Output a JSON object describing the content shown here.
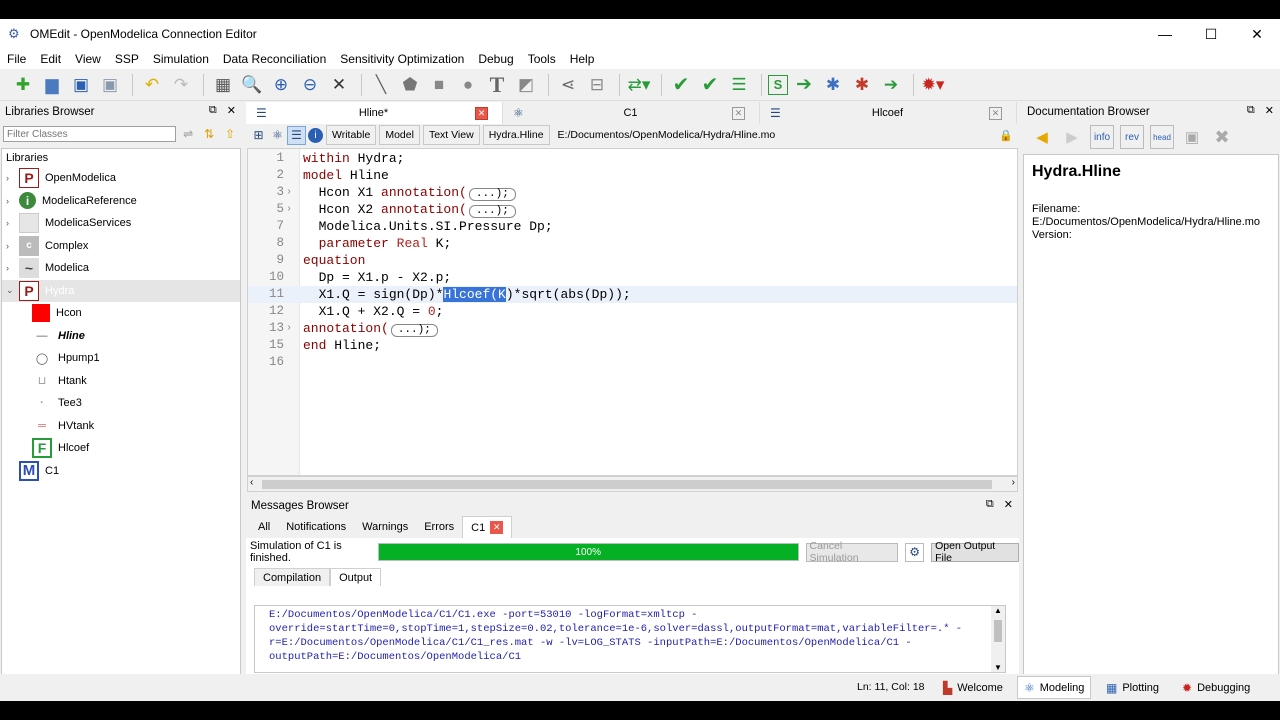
{
  "window": {
    "title": "OMEdit - OpenModelica Connection Editor",
    "minimize": "—",
    "maximize": "☐",
    "close": "✕"
  },
  "menu": [
    "File",
    "Edit",
    "View",
    "SSP",
    "Simulation",
    "Data Reconciliation",
    "Sensitivity Optimization",
    "Debug",
    "Tools",
    "Help"
  ],
  "toolbar_icons": [
    "new-icon",
    "open-icon",
    "save-icon",
    "save-all-icon",
    "undo-icon",
    "redo-icon",
    "grid-icon",
    "zoom-reset-icon",
    "zoom-in-icon",
    "zoom-out-icon",
    "fit-icon",
    "line-icon",
    "polygon-icon",
    "rectangle-icon",
    "ellipse-icon",
    "text-icon",
    "bitmap-icon",
    "connect-icon",
    "transition-icon",
    "check-model-icon",
    "check-all-icon",
    "instantiate-icon",
    "ssp-icon",
    "simulate-icon",
    "simulate-debug-icon",
    "simulate-animation-icon",
    "simulate-alg-icon",
    "debugger-icon"
  ],
  "libraries": {
    "title": "Libraries Browser",
    "filter_placeholder": "Filter Classes",
    "header": "Libraries",
    "items": [
      {
        "label": "OpenModelica",
        "icon": "P",
        "level": 0,
        "arrow": "›"
      },
      {
        "label": "ModelicaReference",
        "icon": "i",
        "level": 0,
        "arrow": "›"
      },
      {
        "label": "ModelicaServices",
        "icon": "",
        "level": 0,
        "arrow": "›"
      },
      {
        "label": "Complex",
        "icon": "c",
        "level": 0,
        "arrow": "›"
      },
      {
        "label": "Modelica",
        "icon": "~",
        "level": 0,
        "arrow": "›"
      },
      {
        "label": "Hydra",
        "icon": "P",
        "level": 0,
        "arrow": "⌄"
      },
      {
        "label": "Hcon",
        "icon": "",
        "level": 1,
        "arrow": ""
      },
      {
        "label": "Hline",
        "icon": "—",
        "level": 1,
        "arrow": ""
      },
      {
        "label": "Hpump1",
        "icon": "◯",
        "level": 1,
        "arrow": ""
      },
      {
        "label": "Htank",
        "icon": "⊔",
        "level": 1,
        "arrow": ""
      },
      {
        "label": "Tee3",
        "icon": "·",
        "level": 1,
        "arrow": ""
      },
      {
        "label": "HVtank",
        "icon": "═",
        "level": 1,
        "arrow": ""
      },
      {
        "label": "Hlcoef",
        "icon": "F",
        "level": 1,
        "arrow": ""
      },
      {
        "label": "C1",
        "icon": "M",
        "level": 0,
        "arrow": ""
      }
    ]
  },
  "editor": {
    "tabs": [
      {
        "label": "Hline*",
        "icon": "☰"
      },
      {
        "label": "C1",
        "icon": "⚛"
      },
      {
        "label": "Hlcoef",
        "icon": "☰"
      }
    ],
    "buttons": [
      "Writable",
      "Model",
      "Text View",
      "Hydra.Hline"
    ],
    "path": "E:/Documentos/OpenModelica/Hydra/Hline.mo",
    "lines": [
      {
        "n": "1"
      },
      {
        "n": "2"
      },
      {
        "n": "3"
      },
      {
        "n": "5"
      },
      {
        "n": "7"
      },
      {
        "n": "8"
      },
      {
        "n": "9"
      },
      {
        "n": "10"
      },
      {
        "n": "11"
      },
      {
        "n": "12"
      },
      {
        "n": "13"
      },
      {
        "n": "15"
      },
      {
        "n": "16"
      }
    ],
    "code": {
      "l1a": "within",
      "l1b": " Hydra;",
      "l2a": "model",
      "l2b": " Hline",
      "l3a": "  Hcon X1 ",
      "l3b": "annotation(",
      "l3c": "...);",
      "l5a": "  Hcon X2 ",
      "l5b": "annotation(",
      "l5c": "...);",
      "l7a": "  Modelica.Units.SI.Pressure Dp;",
      "l8a": "  ",
      "l8b": "parameter",
      "l8c": " ",
      "l8d": "Real",
      "l8e": " K;",
      "l9a": "equation",
      "l10a": "  Dp = X1.p - X2.p;",
      "l11a": "  X1.Q = sign(Dp)*",
      "l11b": "Hlcoef(K",
      "l11c": ")*sqrt(abs(Dp));",
      "l12a": "  X1.Q + X2.Q = ",
      "l12b": "0",
      "l12c": ";",
      "l13a": "annotation(",
      "l13b": "...);",
      "l15a": "end",
      "l15b": " Hline;",
      "l16a": ""
    }
  },
  "messages": {
    "title": "Messages Browser",
    "tabs": [
      "All",
      "Notifications",
      "Warnings",
      "Errors",
      "C1"
    ],
    "sim_status": "Simulation of C1 is finished.",
    "progress": "100%",
    "progress_value": 1.0,
    "cancel_label": "Cancel Simulation",
    "open_output_label": "Open Output File",
    "output_tabs": [
      "Compilation",
      "Output"
    ],
    "output_text": "E:/Documentos/OpenModelica/C1/C1.exe -port=53010 -logFormat=xmltcp -override=startTime=0,stopTime=1,stepSize=0.02,tolerance=1e-6,solver=dassl,outputFormat=mat,variableFilter=.* -r=E:/Documentos/OpenModelica/C1/C1_res.mat -w -lv=LOG_STATS -inputPath=E:/Documentos/OpenModelica/C1 -outputPath=E:/Documentos/OpenModelica/C1"
  },
  "documentation": {
    "title": "Documentation Browser",
    "class_name": "Hydra.Hline",
    "filename_label": "Filename:",
    "filename": "E:/Documentos/OpenModelica/Hydra/Hline.mo",
    "version_label": "Version:",
    "tool_icons": [
      "back-icon",
      "forward-icon",
      "info-icon",
      "revisions-icon",
      "header-icon",
      "save-icon",
      "cancel-icon"
    ]
  },
  "status": {
    "cursor": "Ln: 11, Col: 18",
    "perspectives": [
      "Welcome",
      "Modeling",
      "Plotting",
      "Debugging"
    ],
    "active": "Modeling"
  },
  "colors": {
    "selection": "#3874d8",
    "progress": "#06b025",
    "keyword": "#8b0000",
    "close_red": "#e8574a"
  }
}
